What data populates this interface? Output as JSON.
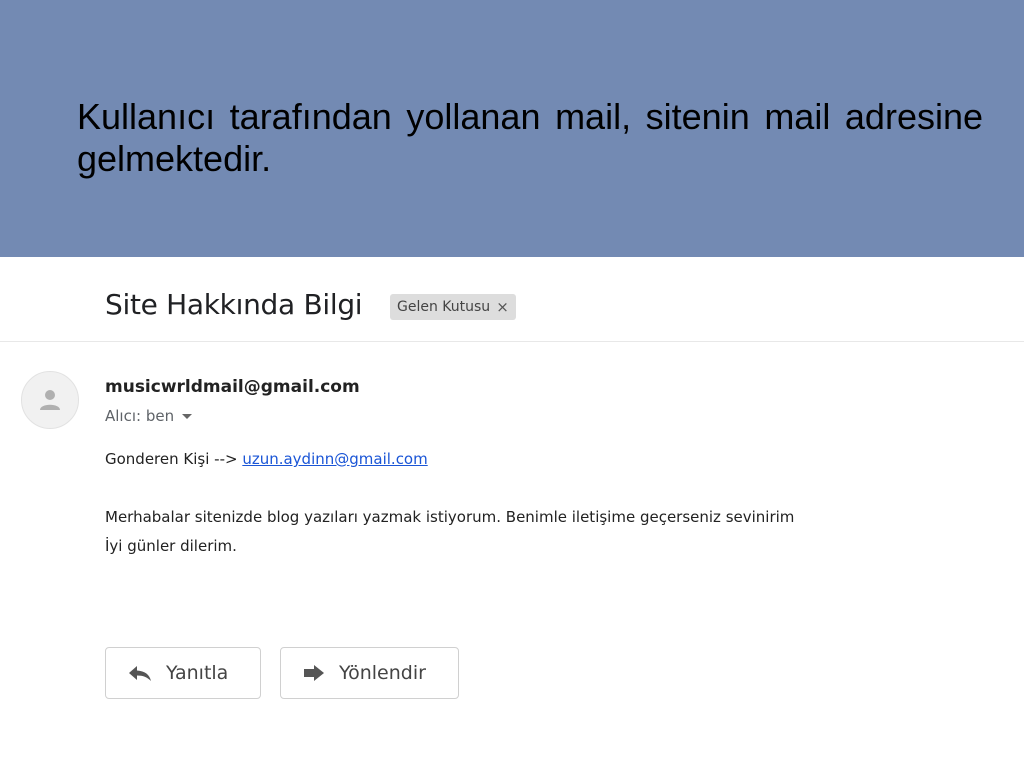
{
  "slide": {
    "caption": "Kullanıcı tarafından yollanan mail, sitenin mail adresine gelmektedir."
  },
  "mail": {
    "subject": "Site Hakkında Bilgi",
    "label": {
      "text": "Gelen Kutusu",
      "close_glyph": "×"
    },
    "sender_email": "musicwrldmail@gmail.com",
    "recipient": "Alıcı: ben",
    "body": {
      "sender_prefix": "Gonderen Kişi -->",
      "sender_link": "uzun.aydinn@gmail.com",
      "line1": "Merhabalar sitenizde blog yazıları yazmak istiyorum. Benimle iletişime geçerseniz sevinirim",
      "line2": "İyi günler dilerim."
    },
    "actions": {
      "reply_label": "Yanıtla",
      "forward_label": "Yönlendir"
    }
  },
  "icons": {
    "avatar": "person-icon",
    "reply": "reply-arrow-icon",
    "forward": "forward-arrow-icon",
    "dropdown": "caret-down-icon"
  },
  "colors": {
    "header_background": "#738ab3",
    "link": "#1a55d6",
    "chip_background": "#dddddd"
  }
}
